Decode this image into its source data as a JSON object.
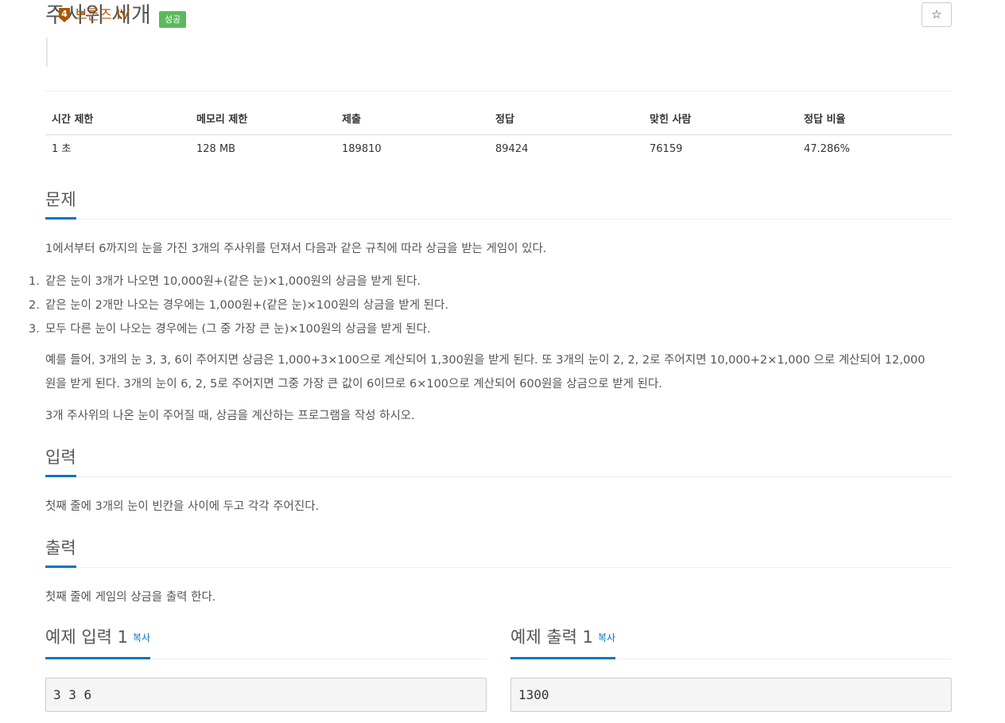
{
  "problem": {
    "title": "주사위 세개",
    "status_badge": "성공",
    "star_icon": "☆",
    "tier": {
      "level": "4",
      "label": "브론즈 IV",
      "color": "#ad5600"
    }
  },
  "stats": {
    "headers": [
      "시간 제한",
      "메모리 제한",
      "제출",
      "정답",
      "맞힌 사람",
      "정답 비율"
    ],
    "values": [
      "1 초",
      "128 MB",
      "189810",
      "89424",
      "76159",
      "47.286%"
    ]
  },
  "sections": {
    "problem_heading": "문제",
    "problem_intro": "1에서부터 6까지의 눈을 가진 3개의 주사위를 던져서 다음과 같은 규칙에 따라 상금을 받는 게임이 있다.",
    "rules": [
      {
        "num": "1.",
        "text": "같은 눈이 3개가 나오면 10,000원+(같은 눈)×1,000원의 상금을 받게 된다."
      },
      {
        "num": "2.",
        "text": "같은 눈이 2개만 나오는 경우에는 1,000원+(같은 눈)×100원의 상금을 받게 된다."
      },
      {
        "num": "3.",
        "text": "모두 다른 눈이 나오는 경우에는 (그 중 가장 큰 눈)×100원의 상금을 받게 된다."
      }
    ],
    "example_line1": "예를 들어, 3개의 눈 3, 3, 6이 주어지면 상금은 1,000+3×100으로 계산되어 1,300원을 받게 된다. 또 3개의 눈이 2, 2, 2로 주어지면 10,000+2×1,000 으로 계산되어 12,000",
    "example_line2": "원을 받게 된다. 3개의 눈이 6, 2, 5로 주어지면 그중 가장 큰 값이 6이므로 6×100으로 계산되어 600원을 상금으로 받게 된다.",
    "task": "3개 주사위의 나온 눈이 주어질 때, 상금을 계산하는 프로그램을 작성 하시오.",
    "input_heading": "입력",
    "input_text": "첫째 줄에 3개의 눈이 빈칸을 사이에 두고 각각 주어진다.",
    "output_heading": "출력",
    "output_text": "첫째 줄에 게임의 상금을 출력 한다."
  },
  "samples": {
    "input_heading": "예제 입력 1",
    "output_heading": "예제 출력 1",
    "copy_label": "복사",
    "input_value": "3 3 6",
    "output_value": "1300"
  },
  "colors": {
    "accent": "#0076c0",
    "success": "#5cb85c",
    "bronze": "#ad5600"
  }
}
